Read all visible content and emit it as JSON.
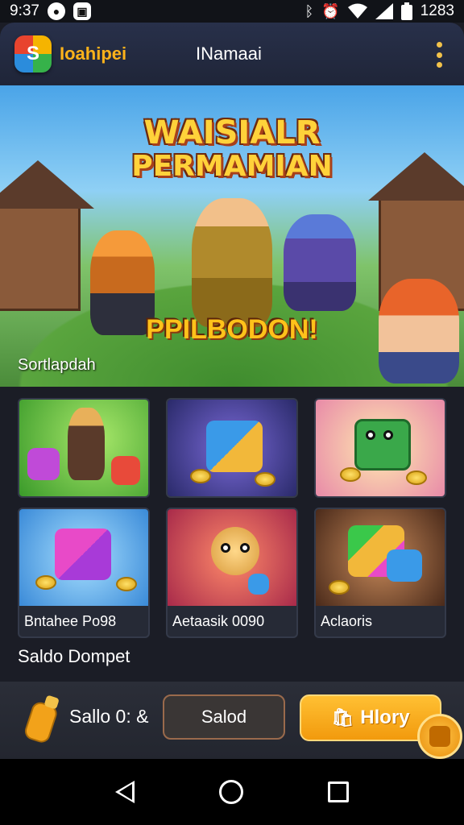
{
  "status_bar": {
    "time_left": "9:37",
    "time_right": "1283",
    "icons": [
      "messenger-icon",
      "notification-icon",
      "bluetooth-icon",
      "alarm-icon",
      "wifi-icon",
      "signal-icon",
      "battery-icon"
    ]
  },
  "app_bar": {
    "brand": "Ioahipei",
    "title": "INamaai",
    "logo_letter": "S"
  },
  "hero": {
    "title_line1": "WAISIALR",
    "title_line2": "PERMAMIAN",
    "subtitle": "PPILBODON!",
    "caption": "Sortlapdah"
  },
  "games": [
    {
      "label": "",
      "theme": "warriors"
    },
    {
      "label": "",
      "theme": "cube-blue"
    },
    {
      "label": "",
      "theme": "cube-green"
    },
    {
      "label": "Bntahee Po98",
      "theme": "gift-cube"
    },
    {
      "label": "Aetaasik 0090",
      "theme": "bomb"
    },
    {
      "label": "Aclaoris",
      "theme": "cube-stack"
    }
  ],
  "section": {
    "title": "Saldo Dompet"
  },
  "bottom_bar": {
    "balance_text": "Sallo 0: &",
    "secondary_button": "Salod",
    "primary_button": "Hlory"
  },
  "colors": {
    "accent": "#ffb31a",
    "background": "#1b1d26",
    "primary_button": "#f4a81e"
  }
}
